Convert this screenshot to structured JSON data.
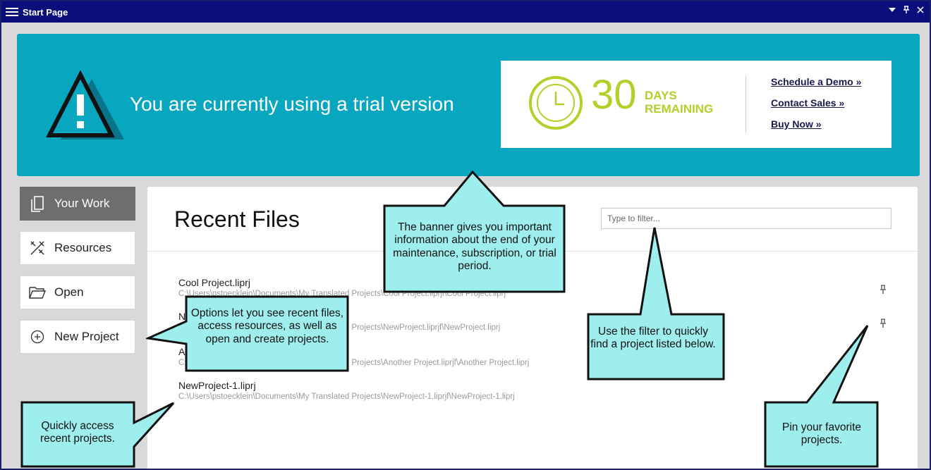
{
  "window": {
    "title": "Start Page"
  },
  "banner": {
    "trial_text": "You are currently using a trial version",
    "days_number": "30",
    "days_label_line1": "DAYS",
    "days_label_line2": "REMAINING",
    "links": [
      "Schedule a Demo »",
      "Contact Sales »",
      "Buy Now »"
    ]
  },
  "nav": {
    "items": [
      {
        "label": "Your Work",
        "icon": "document-icon",
        "active": true
      },
      {
        "label": "Resources",
        "icon": "tools-icon"
      },
      {
        "label": "Open",
        "icon": "folder-icon"
      },
      {
        "label": "New Project",
        "icon": "plus-circle-icon"
      }
    ]
  },
  "main": {
    "heading": "Recent Files",
    "filter_placeholder": "Type to filter...",
    "files": [
      {
        "name": "Cool Project.liprj",
        "path": "C:\\Users\\pstoecklein\\Documents\\My Translated Projects\\Cool Project.liprjf\\Cool Project.liprj"
      },
      {
        "name": "N",
        "path": "C:\\Users\\pstoecklein\\Documents\\My Translated Projects\\NewProject.liprjf\\NewProject.liprj"
      },
      {
        "name": "A",
        "path": "C:\\Users\\pstoecklein\\Documents\\My Translated Projects\\Another Project.liprjf\\Another Project.liprj"
      },
      {
        "name": "NewProject-1.liprj",
        "path": "C:\\Users\\pstoecklein\\Documents\\My Translated Projects\\NewProject-1.liprjf\\NewProject-1.liprj"
      }
    ]
  },
  "callouts": {
    "banner": "The banner gives you important information about the end of your maintenance, subscription, or trial period.",
    "options": "Options let you see recent files, access resources, as well as open and create projects.",
    "filter": "Use the filter to quickly find a project listed below.",
    "recent": "Quickly access recent projects.",
    "pin": "Pin your favorite projects."
  },
  "colors": {
    "titlebar": "#0a0e7a",
    "banner": "#09a6c0",
    "accent_green": "#b5cf2a",
    "callout_fill": "#9eeeee"
  }
}
